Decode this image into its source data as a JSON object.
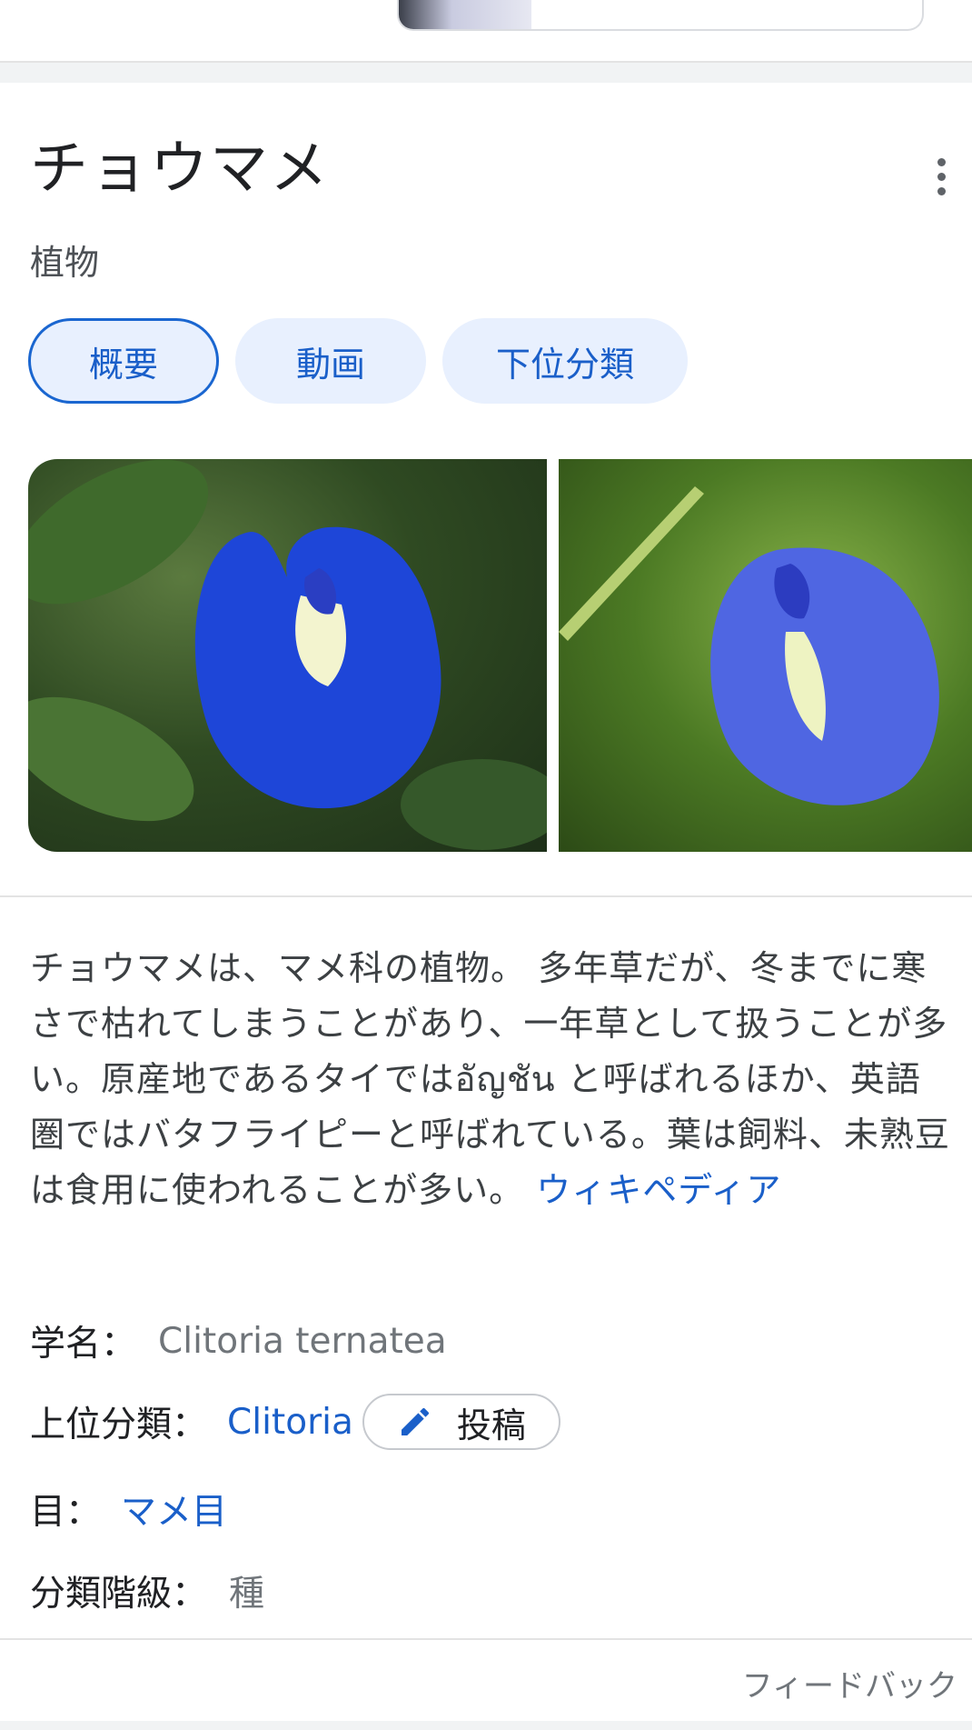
{
  "entity": {
    "title": "チョウマメ",
    "subtitle": "植物"
  },
  "tabs": [
    {
      "label": "概要",
      "active": true
    },
    {
      "label": "動画",
      "active": false
    },
    {
      "label": "下位分類",
      "active": false
    }
  ],
  "description": {
    "text": "チョウマメは、マメ科の植物。 多年草だが、冬までに寒さで枯れてしまうことがあり、一年草として扱うことが多い。原産地であるタイではอัญชัน と呼ばれるほか、英語圏ではバタフライピーと呼ばれている。葉は飼料、未熟豆は食用に使われることが多い。",
    "source_link": "ウィキペディア"
  },
  "facts": {
    "scientific_name": {
      "label": "学名：",
      "value": "Clitoria ternatea"
    },
    "parent_taxon": {
      "label": "上位分類：",
      "value": "Clitoria",
      "contribute_label": "投稿"
    },
    "order": {
      "label": "目：",
      "value": "マメ目"
    },
    "rank": {
      "label": "分類階級：",
      "value": "種"
    }
  },
  "footer": {
    "feedback_label": "フィードバック"
  },
  "icons": [
    "more-vert-icon",
    "pencil-icon"
  ],
  "colors": {
    "link": "#1a5fc9",
    "chip_bg": "#e8f0fe",
    "chip_active_border": "#1a66d0"
  }
}
